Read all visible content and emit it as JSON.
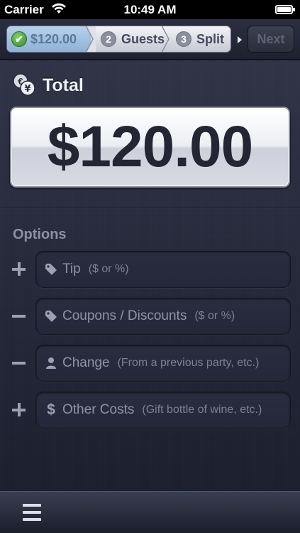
{
  "status_bar": {
    "carrier": "Carrier",
    "time": "10:49 AM",
    "icons": [
      "wifi-icon",
      "battery-icon"
    ]
  },
  "stepper": {
    "steps": [
      {
        "number": "",
        "label": "$120.00",
        "state": "completed",
        "icon": "checkmark-icon"
      },
      {
        "number": "2",
        "label": "Guests",
        "state": "upcoming"
      },
      {
        "number": "3",
        "label": "Split",
        "state": "upcoming"
      }
    ],
    "next_label": "Next",
    "next_enabled": false
  },
  "total": {
    "label": "Total",
    "icon": "currency-icon",
    "value": "$120.00"
  },
  "options": {
    "label": "Options",
    "items": [
      {
        "sign": "+",
        "icon": "tag-icon",
        "name": "Tip",
        "hint": "($ or %)"
      },
      {
        "sign": "−",
        "icon": "tag-icon",
        "name": "Coupons / Discounts",
        "hint": "($ or %)"
      },
      {
        "sign": "−",
        "icon": "person-icon",
        "name": "Change",
        "hint": "(From a previous party, etc.)"
      },
      {
        "sign": "+",
        "icon": "dollar-icon",
        "name": "Other Costs",
        "hint": "(Gift bottle of wine, etc.)"
      }
    ]
  },
  "toolbar": {
    "menu_icon": "menu-icon"
  },
  "colors": {
    "completed_step": "#a3c2e2",
    "background": "#252839",
    "display_text": "#242634"
  }
}
